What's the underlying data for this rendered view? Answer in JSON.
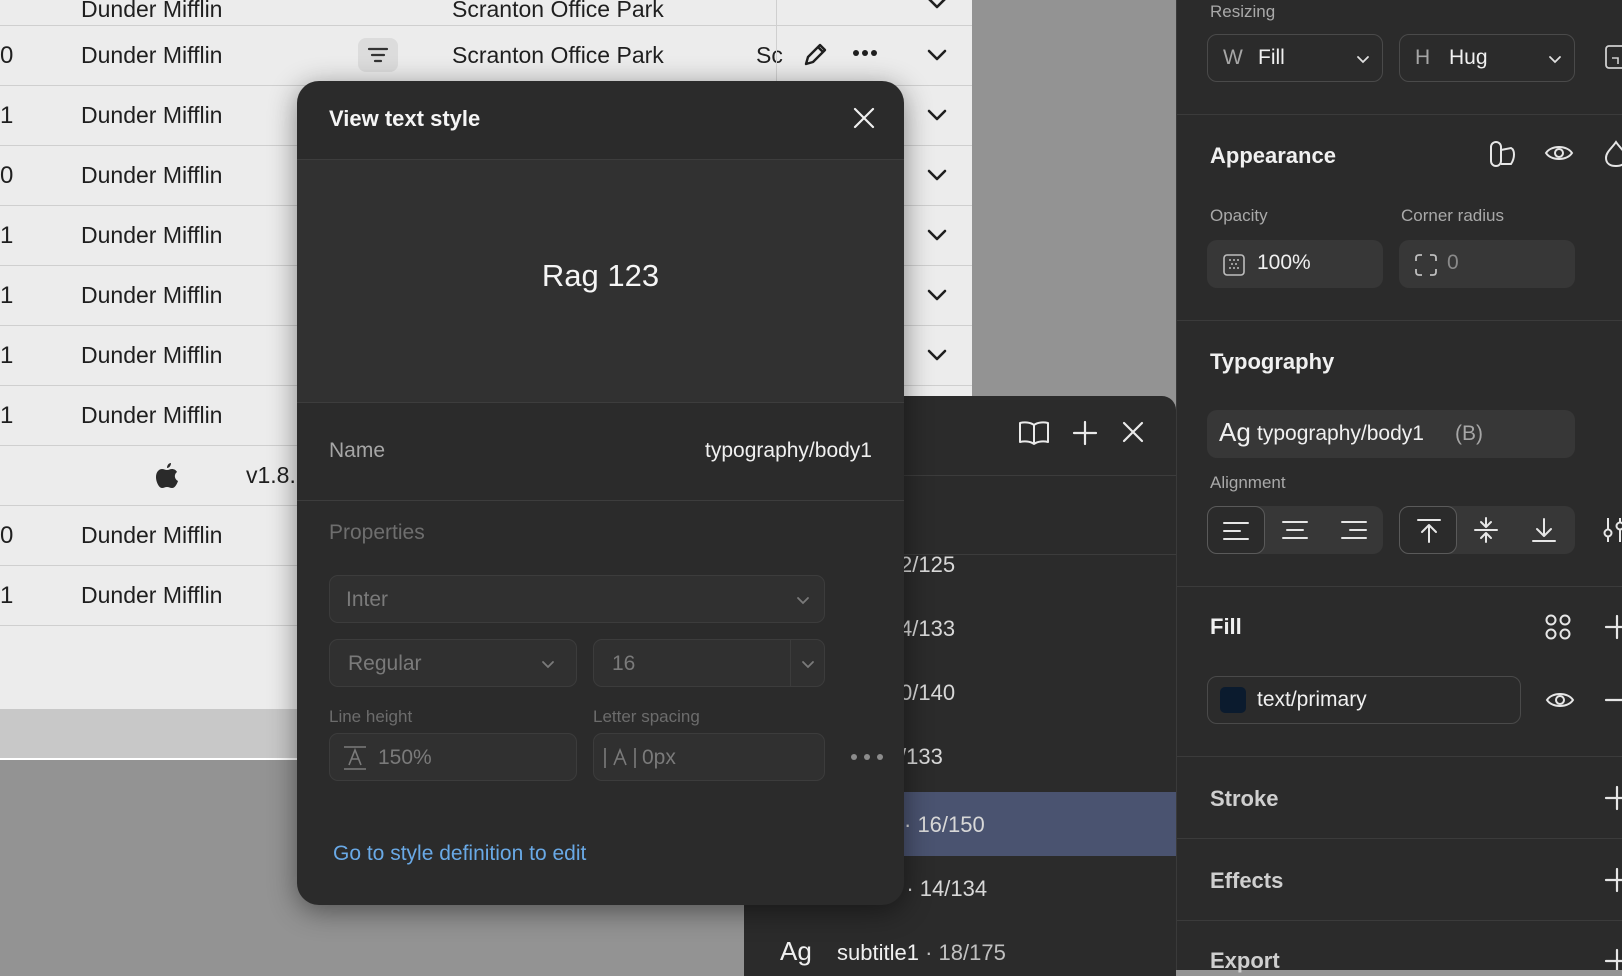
{
  "table": {
    "top_row": {
      "company": "Dunder Mifflin",
      "location": "Scranton Office Park"
    },
    "row_with_actions": {
      "num": "0",
      "company": "Dunder Mifflin",
      "location": "Scranton Office Park",
      "col_s": "Sc"
    },
    "rows": [
      {
        "num": "1",
        "company": "Dunder Mifflin"
      },
      {
        "num": "0",
        "company": "Dunder Mifflin"
      },
      {
        "num": "1",
        "company": "Dunder Mifflin"
      },
      {
        "num": "1",
        "company": "Dunder Mifflin"
      },
      {
        "num": "1",
        "company": "Dunder Mifflin"
      },
      {
        "num": "1",
        "company": "Dunder Mifflin"
      }
    ],
    "version_row": {
      "version": "v1.8."
    },
    "rows_bottom": [
      {
        "num": "0",
        "company": "Dunder Mifflin"
      },
      {
        "num": "1",
        "company": "Dunder Mifflin"
      }
    ]
  },
  "modal": {
    "title": "View text style",
    "preview_text": "Rag 123",
    "name_label": "Name",
    "name_value": "typography/body1",
    "properties_label": "Properties",
    "font_family": "Inter",
    "font_weight": "Regular",
    "font_size": "16",
    "line_height_label": "Line height",
    "line_height_value": "150%",
    "letter_spacing_label": "Letter spacing",
    "letter_spacing_value": "0px",
    "edit_link": "Go to style definition to edit"
  },
  "style_list": {
    "items": [
      {
        "meta": "2/125"
      },
      {
        "meta": "4/133"
      },
      {
        "meta": "0/140"
      },
      {
        "meta": "/133"
      },
      {
        "meta": "· 16/150",
        "selected": true
      },
      {
        "meta": "1 · 14/134"
      }
    ],
    "last_item": {
      "ag": "Ag",
      "name": "subtitle1",
      "meta": "· 18/175"
    }
  },
  "inspector": {
    "resizing_label": "Resizing",
    "width_prefix": "W",
    "width_value": "Fill",
    "height_prefix": "H",
    "height_value": "Hug",
    "appearance_heading": "Appearance",
    "opacity_label": "Opacity",
    "opacity_value": "100%",
    "corner_radius_label": "Corner radius",
    "corner_radius_value": "0",
    "typography_heading": "Typography",
    "typography_ag": "Ag",
    "typography_style": "typography/body1",
    "typography_suffix": "(B)",
    "alignment_label": "Alignment",
    "fill_heading": "Fill",
    "fill_value": "text/primary",
    "fill_swatch_color": "#0b1b2e",
    "stroke_heading": "Stroke",
    "effects_heading": "Effects",
    "export_heading": "Export"
  },
  "colors": {
    "accent_link": "#69a9e6",
    "selected_row": "#4a5370"
  }
}
